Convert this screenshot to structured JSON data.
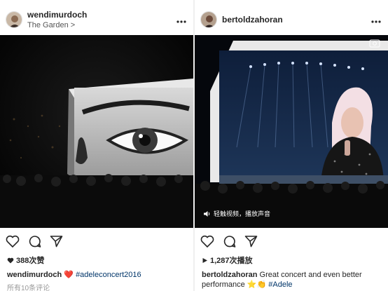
{
  "posts": [
    {
      "username": "wendimurdoch",
      "location": "The Garden",
      "location_chevron": ">",
      "more_icon": "more-horizontal-icon",
      "likes": "388次赞",
      "caption_user": "wendimurdoch",
      "caption_emoji": "❤️",
      "caption_text": "#adeleconcert2016",
      "comments_link": "所有10条评论",
      "actions": [
        "heart-icon",
        "comment-icon",
        "share-icon"
      ]
    },
    {
      "username": "bertoldzahoran",
      "more_icon": "more-horizontal-icon",
      "video_hint": "轻触视频，播放声音",
      "views": "1,287次播放",
      "caption_user": "bertoldzahoran",
      "caption_text": "Great concert and even better performance",
      "caption_emoji": "⭐👏",
      "caption_tag": "#Adele",
      "actions": [
        "heart-icon",
        "comment-icon",
        "share-icon"
      ]
    }
  ],
  "colors": {
    "hashtag": "#003569",
    "text": "#262626",
    "muted": "#999999"
  }
}
